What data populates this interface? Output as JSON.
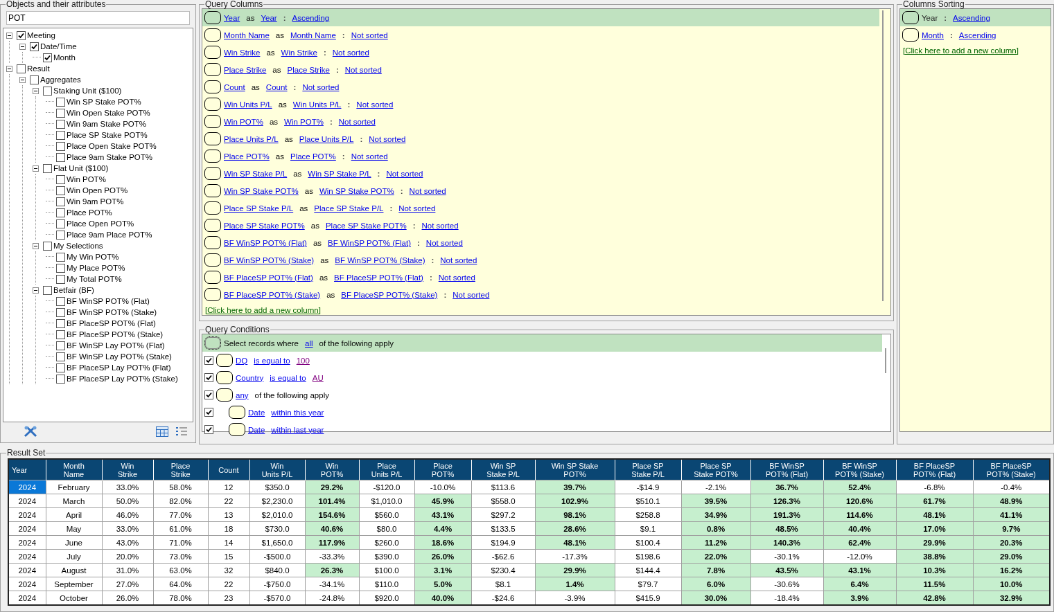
{
  "objects_panel": {
    "title": "Objects and their attributes",
    "search": {
      "value": "POT"
    },
    "tree": [
      {
        "label": "Meeting",
        "checked": true,
        "expanded": true,
        "children": [
          {
            "label": "Date/Time",
            "checked": true,
            "expanded": true,
            "children": [
              {
                "label": "Month",
                "checked": true
              }
            ]
          }
        ]
      },
      {
        "label": "Result",
        "checked": false,
        "expanded": true,
        "children": [
          {
            "label": "Aggregates",
            "checked": false,
            "expanded": true,
            "children": [
              {
                "label": "Staking Unit ($100)",
                "checked": false,
                "expanded": true,
                "children": [
                  {
                    "label": "Win SP Stake POT%",
                    "checked": false
                  },
                  {
                    "label": "Win Open Stake POT%",
                    "checked": false
                  },
                  {
                    "label": "Win 9am Stake POT%",
                    "checked": false
                  },
                  {
                    "label": "Place SP Stake POT%",
                    "checked": false
                  },
                  {
                    "label": "Place Open Stake POT%",
                    "checked": false
                  },
                  {
                    "label": "Place 9am Stake POT%",
                    "checked": false
                  }
                ]
              },
              {
                "label": "Flat Unit ($100)",
                "checked": false,
                "expanded": true,
                "children": [
                  {
                    "label": "Win POT%",
                    "checked": false
                  },
                  {
                    "label": "Win Open POT%",
                    "checked": false
                  },
                  {
                    "label": "Win 9am POT%",
                    "checked": false
                  },
                  {
                    "label": "Place POT%",
                    "checked": false
                  },
                  {
                    "label": "Place Open POT%",
                    "checked": false
                  },
                  {
                    "label": "Place 9am Place POT%",
                    "checked": false
                  }
                ]
              },
              {
                "label": "My Selections",
                "checked": false,
                "expanded": true,
                "children": [
                  {
                    "label": "My Win POT%",
                    "checked": false
                  },
                  {
                    "label": "My Place POT%",
                    "checked": false
                  },
                  {
                    "label": "My Total POT%",
                    "checked": false
                  }
                ]
              },
              {
                "label": "Betfair (BF)",
                "checked": false,
                "expanded": true,
                "children": [
                  {
                    "label": "BF WinSP POT% (Flat)",
                    "checked": false
                  },
                  {
                    "label": "BF WinSP POT% (Stake)",
                    "checked": false
                  },
                  {
                    "label": "BF PlaceSP POT% (Flat)",
                    "checked": false
                  },
                  {
                    "label": "BF PlaceSP POT% (Stake)",
                    "checked": false
                  },
                  {
                    "label": "BF WinSP Lay POT% (Flat)",
                    "checked": false
                  },
                  {
                    "label": "BF WinSP Lay POT% (Stake)",
                    "checked": false
                  },
                  {
                    "label": "BF PlaceSP Lay POT% (Flat)",
                    "checked": false
                  },
                  {
                    "label": "BF PlaceSP Lay POT% (Stake)",
                    "checked": false
                  }
                ]
              }
            ]
          }
        ]
      }
    ]
  },
  "query_columns": {
    "title": "Query Columns",
    "columns": [
      {
        "field": "Year",
        "as": "as",
        "alias": "Year",
        "colon": ":",
        "sort": "Ascending",
        "selected": true
      },
      {
        "field": "Month Name",
        "as": "as",
        "alias": "Month Name",
        "colon": ":",
        "sort": "Not sorted",
        "selected": false
      },
      {
        "field": "Win Strike",
        "as": "as",
        "alias": "Win Strike",
        "colon": ":",
        "sort": "Not sorted",
        "selected": false
      },
      {
        "field": "Place Strike",
        "as": "as",
        "alias": "Place Strike",
        "colon": ":",
        "sort": "Not sorted",
        "selected": false
      },
      {
        "field": "Count",
        "as": "as",
        "alias": "Count",
        "colon": ":",
        "sort": "Not sorted",
        "selected": false
      },
      {
        "field": "Win Units P/L",
        "as": "as",
        "alias": "Win Units P/L",
        "colon": ":",
        "sort": "Not sorted",
        "selected": false
      },
      {
        "field": "Win POT%",
        "as": "as",
        "alias": "Win POT%",
        "colon": ":",
        "sort": "Not sorted",
        "selected": false
      },
      {
        "field": "Place Units P/L",
        "as": "as",
        "alias": "Place Units P/L",
        "colon": ":",
        "sort": "Not sorted",
        "selected": false
      },
      {
        "field": "Place POT%",
        "as": "as",
        "alias": "Place POT%",
        "colon": ":",
        "sort": "Not sorted",
        "selected": false
      },
      {
        "field": "Win SP Stake P/L",
        "as": "as",
        "alias": "Win SP Stake P/L",
        "colon": ":",
        "sort": "Not sorted",
        "selected": false
      },
      {
        "field": "Win SP Stake POT%",
        "as": "as",
        "alias": "Win SP Stake POT%",
        "colon": ":",
        "sort": "Not sorted",
        "selected": false
      },
      {
        "field": "Place SP Stake P/L",
        "as": "as",
        "alias": "Place SP Stake P/L",
        "colon": ":",
        "sort": "Not sorted",
        "selected": false
      },
      {
        "field": "Place SP Stake POT%",
        "as": "as",
        "alias": "Place SP Stake POT%",
        "colon": ":",
        "sort": "Not sorted",
        "selected": false
      },
      {
        "field": "BF WinSP POT% (Flat)",
        "as": "as",
        "alias": "BF WinSP POT% (Flat)",
        "colon": ":",
        "sort": "Not sorted",
        "selected": false
      },
      {
        "field": "BF WinSP POT% (Stake)",
        "as": "as",
        "alias": "BF WinSP POT% (Stake)",
        "colon": ":",
        "sort": "Not sorted",
        "selected": false
      },
      {
        "field": "BF PlaceSP POT% (Flat)",
        "as": "as",
        "alias": "BF PlaceSP POT% (Flat)",
        "colon": ":",
        "sort": "Not sorted",
        "selected": false
      },
      {
        "field": "BF PlaceSP POT% (Stake)",
        "as": "as",
        "alias": "BF PlaceSP POT% (Stake)",
        "colon": ":",
        "sort": "Not sorted",
        "selected": false
      }
    ],
    "add_link": "[Click here to add a new column]"
  },
  "columns_sorting": {
    "title": "Columns Sorting",
    "items": [
      {
        "column": "Year",
        "column_link": false,
        "colon": ":",
        "sort": "Ascending",
        "selected": true
      },
      {
        "column": "Month",
        "column_link": true,
        "colon": ":",
        "sort": "Ascending",
        "selected": false
      }
    ],
    "add_link": "[Click here to add a new column]"
  },
  "query_conditions": {
    "title": "Query Conditions",
    "root": {
      "prefix": "Select records where",
      "quantifier": "all",
      "suffix": "of the following apply",
      "selected": true
    },
    "items": [
      {
        "kind": "condition",
        "checked": true,
        "field": "DQ",
        "operator": "is equal to",
        "value": "100"
      },
      {
        "kind": "condition",
        "checked": true,
        "field": "Country",
        "operator": "is equal to",
        "value": "AU"
      },
      {
        "kind": "group",
        "checked": true,
        "quantifier": "any",
        "suffix": "of the following apply",
        "children": [
          {
            "kind": "condition",
            "checked": true,
            "field": "Date",
            "operator": "within this year"
          },
          {
            "kind": "condition",
            "checked": true,
            "field": "Date",
            "operator": "within last year"
          }
        ]
      }
    ]
  },
  "result_set": {
    "title": "Result Set",
    "columns": [
      "Year",
      "Month\nName",
      "Win\nStrike",
      "Place\nStrike",
      "Count",
      "Win\nUnits P/L",
      "Win\nPOT%",
      "Place\nUnits P/L",
      "Place\nPOT%",
      "Win SP\nStake P/L",
      "Win SP Stake\nPOT%",
      "Place SP\nStake P/L",
      "Place SP\nStake POT%",
      "BF WinSP\nPOT% (Flat)",
      "BF WinSP\nPOT% (Stake)",
      "BF PlaceSP\nPOT% (Flat)",
      "BF PlaceSP\nPOT% (Stake)"
    ],
    "rows": [
      {
        "selected": true,
        "cells": [
          "2024",
          "February",
          "33.0%",
          "58.0%",
          "12",
          "$350.0",
          "29.2%",
          "-$120.0",
          "-10.0%",
          "$113.6",
          "39.7%",
          "-$14.9",
          "-2.1%",
          "36.7%",
          "52.4%",
          "-6.8%",
          "-0.4%"
        ],
        "highlight": [
          false,
          false,
          false,
          false,
          false,
          false,
          true,
          false,
          false,
          false,
          true,
          false,
          false,
          true,
          true,
          false,
          false
        ]
      },
      {
        "selected": false,
        "cells": [
          "2024",
          "March",
          "50.0%",
          "82.0%",
          "22",
          "$2,230.0",
          "101.4%",
          "$1,010.0",
          "45.9%",
          "$558.0",
          "102.9%",
          "$510.1",
          "39.5%",
          "126.3%",
          "120.6%",
          "61.7%",
          "48.9%"
        ],
        "highlight": [
          false,
          false,
          false,
          false,
          false,
          false,
          true,
          false,
          true,
          false,
          true,
          false,
          true,
          true,
          true,
          true,
          true
        ]
      },
      {
        "selected": false,
        "cells": [
          "2024",
          "April",
          "46.0%",
          "77.0%",
          "13",
          "$2,010.0",
          "154.6%",
          "$560.0",
          "43.1%",
          "$297.2",
          "98.1%",
          "$258.8",
          "34.9%",
          "191.3%",
          "114.6%",
          "48.1%",
          "41.1%"
        ],
        "highlight": [
          false,
          false,
          false,
          false,
          false,
          false,
          true,
          false,
          true,
          false,
          true,
          false,
          true,
          true,
          true,
          true,
          true
        ]
      },
      {
        "selected": false,
        "cells": [
          "2024",
          "May",
          "33.0%",
          "61.0%",
          "18",
          "$730.0",
          "40.6%",
          "$80.0",
          "4.4%",
          "$133.5",
          "28.6%",
          "$9.1",
          "0.8%",
          "48.5%",
          "40.4%",
          "17.0%",
          "9.7%"
        ],
        "highlight": [
          false,
          false,
          false,
          false,
          false,
          false,
          true,
          false,
          true,
          false,
          true,
          false,
          true,
          true,
          true,
          true,
          true
        ]
      },
      {
        "selected": false,
        "cells": [
          "2024",
          "June",
          "43.0%",
          "71.0%",
          "14",
          "$1,650.0",
          "117.9%",
          "$260.0",
          "18.6%",
          "$194.9",
          "48.1%",
          "$100.4",
          "11.2%",
          "140.3%",
          "62.4%",
          "29.9%",
          "20.3%"
        ],
        "highlight": [
          false,
          false,
          false,
          false,
          false,
          false,
          true,
          false,
          true,
          false,
          true,
          false,
          true,
          true,
          true,
          true,
          true
        ]
      },
      {
        "selected": false,
        "cells": [
          "2024",
          "July",
          "20.0%",
          "73.0%",
          "15",
          "-$500.0",
          "-33.3%",
          "$390.0",
          "26.0%",
          "-$62.6",
          "-17.3%",
          "$198.6",
          "22.0%",
          "-30.1%",
          "-12.0%",
          "38.8%",
          "29.0%"
        ],
        "highlight": [
          false,
          false,
          false,
          false,
          false,
          false,
          false,
          false,
          true,
          false,
          false,
          false,
          true,
          false,
          false,
          true,
          true
        ]
      },
      {
        "selected": false,
        "cells": [
          "2024",
          "August",
          "31.0%",
          "63.0%",
          "32",
          "$840.0",
          "26.3%",
          "$100.0",
          "3.1%",
          "$230.4",
          "29.9%",
          "$144.4",
          "7.8%",
          "43.5%",
          "43.1%",
          "10.3%",
          "16.2%"
        ],
        "highlight": [
          false,
          false,
          false,
          false,
          false,
          false,
          true,
          false,
          true,
          false,
          true,
          false,
          true,
          true,
          true,
          true,
          true
        ]
      },
      {
        "selected": false,
        "cells": [
          "2024",
          "September",
          "27.0%",
          "64.0%",
          "22",
          "-$750.0",
          "-34.1%",
          "$110.0",
          "5.0%",
          "$8.1",
          "1.4%",
          "$79.7",
          "6.0%",
          "-30.6%",
          "6.4%",
          "11.5%",
          "10.0%"
        ],
        "highlight": [
          false,
          false,
          false,
          false,
          false,
          false,
          false,
          false,
          true,
          false,
          true,
          false,
          true,
          false,
          true,
          true,
          true
        ]
      },
      {
        "selected": false,
        "cells": [
          "2024",
          "October",
          "26.0%",
          "78.0%",
          "23",
          "-$570.0",
          "-24.8%",
          "$920.0",
          "40.0%",
          "-$24.6",
          "-3.9%",
          "$415.9",
          "30.0%",
          "-18.4%",
          "3.9%",
          "42.8%",
          "32.9%"
        ],
        "highlight": [
          false,
          false,
          false,
          false,
          false,
          false,
          false,
          false,
          true,
          false,
          false,
          false,
          true,
          false,
          true,
          true,
          true
        ]
      }
    ]
  }
}
